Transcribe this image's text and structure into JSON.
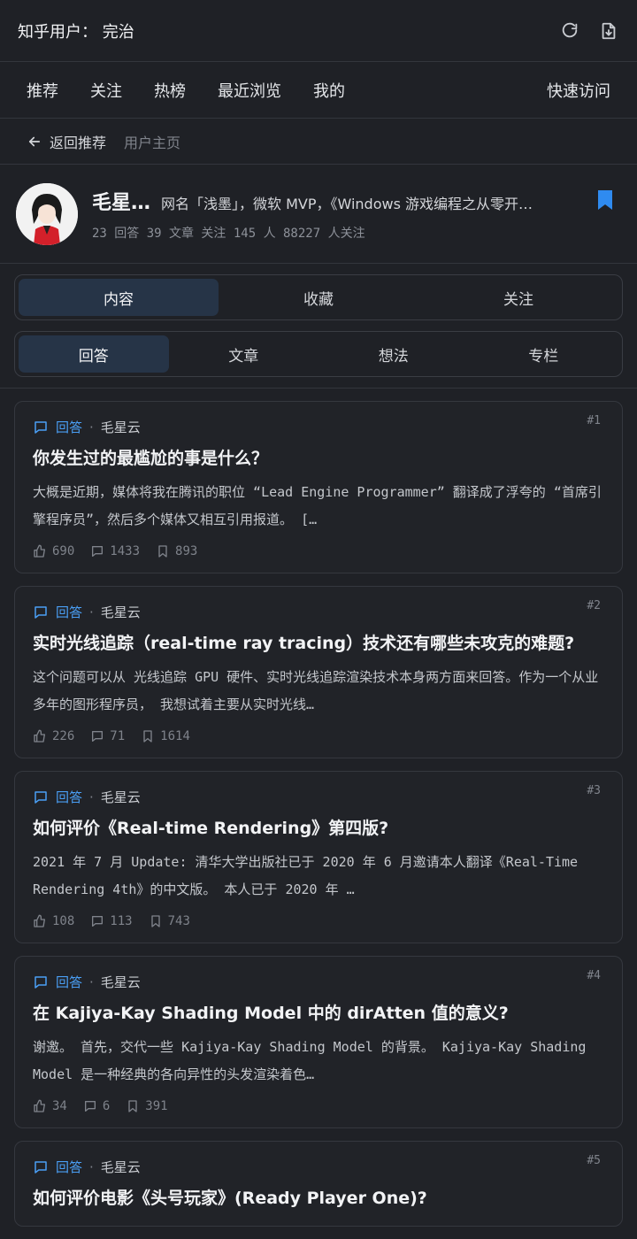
{
  "header": {
    "title": "知乎用户： 完治"
  },
  "nav": {
    "items": [
      "推荐",
      "关注",
      "热榜",
      "最近浏览",
      "我的"
    ],
    "quick": "快速访问"
  },
  "breadcrumb": {
    "back": "返回推荐",
    "current": "用户主页"
  },
  "profile": {
    "name": "毛星…",
    "bio": "网名「浅墨」，微软 MVP，《Windows 游戏编程之从零开…",
    "stats": "23 回答  39 文章  关注 145 人  88227 人关注"
  },
  "tabs": [
    "内容",
    "收藏",
    "关注"
  ],
  "subtabs": [
    "回答",
    "文章",
    "想法",
    "专栏"
  ],
  "colors": {
    "accent": "#4a9ff5",
    "bg": "#1f2126",
    "active_tab": "#263447"
  },
  "cards": [
    {
      "num": "#1",
      "type": "回答",
      "author": "毛星云",
      "title": "你发生过的最尴尬的事是什么？",
      "excerpt": "大概是近期，媒体将我在腾讯的职位 “Lead Engine Programmer” 翻译成了浮夸的 “首席引擎程序员”，然后多个媒体又相互引用报道。 […",
      "likes": "690",
      "comments": "1433",
      "saves": "893"
    },
    {
      "num": "#2",
      "type": "回答",
      "author": "毛星云",
      "title": "实时光线追踪（real-time ray tracing）技术还有哪些未攻克的难题?",
      "excerpt": "这个问题可以从 光线追踪 GPU 硬件、实时光线追踪渲染技术本身两方面来回答。作为一个从业多年的图形程序员， 我想试着主要从实时光线…",
      "likes": "226",
      "comments": "71",
      "saves": "1614"
    },
    {
      "num": "#3",
      "type": "回答",
      "author": "毛星云",
      "title": "如何评价《Real-time Rendering》第四版?",
      "excerpt": "2021 年 7 月 Update:  清华大学出版社已于 2020 年 6 月邀请本人翻译《Real-Time Rendering 4th》的中文版。 本人已于 2020 年 …",
      "likes": "108",
      "comments": "113",
      "saves": "743"
    },
    {
      "num": "#4",
      "type": "回答",
      "author": "毛星云",
      "title": "在 Kajiya-Kay Shading Model 中的 dirAtten 值的意义?",
      "excerpt": "谢邀。 首先，交代一些 Kajiya-Kay Shading Model 的背景。 Kajiya-Kay Shading Model 是一种经典的各向异性的头发渲染着色…",
      "likes": "34",
      "comments": "6",
      "saves": "391"
    },
    {
      "num": "#5",
      "type": "回答",
      "author": "毛星云",
      "title": "如何评价电影《头号玩家》(Ready Player One)?",
      "excerpt": "",
      "likes": "",
      "comments": "",
      "saves": ""
    }
  ]
}
